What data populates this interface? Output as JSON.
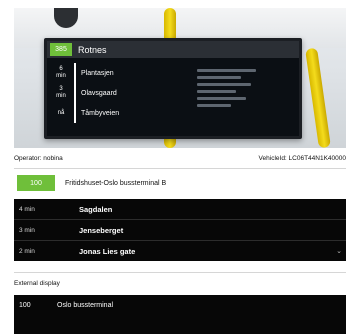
{
  "photo": {
    "route": "385",
    "destination": "Rotnes",
    "stops": [
      {
        "min": "6\nmin",
        "name": "Plantasjen"
      },
      {
        "min": "3\nmin",
        "name": "Olavsgaard"
      },
      {
        "min": "nå",
        "name": "Tåmbyveien"
      }
    ]
  },
  "info": {
    "operator": "Operator: nobina",
    "vehicle": "VehicleId: LC06T44N1K40000"
  },
  "route": {
    "number": "100",
    "name": "Fritidshuset-Oslo bussterminal B"
  },
  "departures": [
    {
      "min": "4 min",
      "stop": "Sagdalen"
    },
    {
      "min": "3 min",
      "stop": "Jenseberget"
    },
    {
      "min": "2 min",
      "stop": "Jonas Lies gate"
    }
  ],
  "external": {
    "title": "External display",
    "number": "100",
    "destination": "Oslo bussterminal"
  },
  "colors": {
    "route_green": "#6fbf3a",
    "panel_black": "#070707"
  }
}
